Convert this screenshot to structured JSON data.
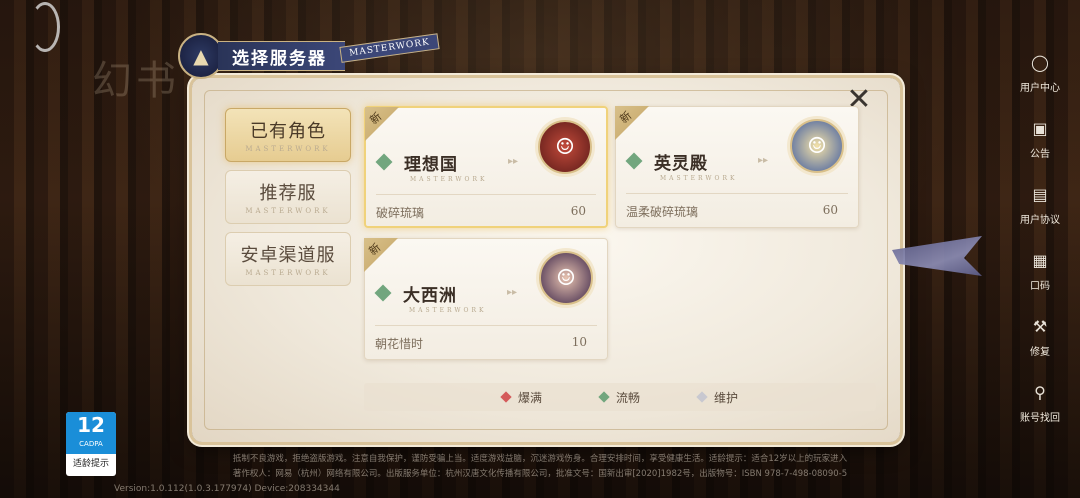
{
  "title": "选择服务器",
  "title_tag": "MASTERWORK",
  "bg_logo": "幻书",
  "tabs": [
    {
      "label": "已有角色",
      "sub": "MASTERWORK",
      "active": true
    },
    {
      "label": "推荐服",
      "sub": "MASTERWORK",
      "active": false
    },
    {
      "label": "安卓渠道服",
      "sub": "MASTERWORK",
      "active": false
    }
  ],
  "servers": [
    {
      "badge": "新",
      "name": "理想国",
      "sub": "MASTERWORK",
      "character": "破碎琉璃",
      "level": "60",
      "status_color": "#72a67e",
      "selected": true
    },
    {
      "badge": "新",
      "name": "英灵殿",
      "sub": "MASTERWORK",
      "character": "温柔破碎琉璃",
      "level": "60",
      "status_color": "#72a67e",
      "selected": false
    },
    {
      "badge": "新",
      "name": "大西洲",
      "sub": "MASTERWORK",
      "character": "朝花惜时",
      "level": "10",
      "status_color": "#72a67e",
      "selected": false
    }
  ],
  "legend": [
    {
      "label": "爆满",
      "color": "#d45a5a"
    },
    {
      "label": "流畅",
      "color": "#72a67e"
    },
    {
      "label": "维护",
      "color": "#c8c8d0"
    }
  ],
  "right_nav": [
    {
      "label": "用户中心",
      "icon": "user-icon"
    },
    {
      "label": "公告",
      "icon": "notice-icon"
    },
    {
      "label": "用户协议",
      "icon": "document-icon"
    },
    {
      "label": "口码",
      "icon": "code-icon"
    },
    {
      "label": "修复",
      "icon": "repair-icon"
    },
    {
      "label": "账号找回",
      "icon": "account-recover-icon"
    }
  ],
  "age_rating": {
    "number": "12",
    "org": "CADPA",
    "text": "适龄提示"
  },
  "footer": {
    "line1": "抵制不良游戏，拒绝盗版游戏。注意自我保护，谨防受骗上当。适度游戏益脑，沉迷游戏伤身。合理安排时间，享受健康生活。适龄提示：适合12岁以上的玩家进入",
    "line2": "著作权人：网易（杭州）网络有限公司。出版服务单位：杭州汉唐文化传播有限公司，批准文号：国新出审[2020]1982号，出版物号：ISBN 978-7-498-08090-5",
    "version": "Version:1.0.112(1.0.3.177974) Device:208334344"
  }
}
